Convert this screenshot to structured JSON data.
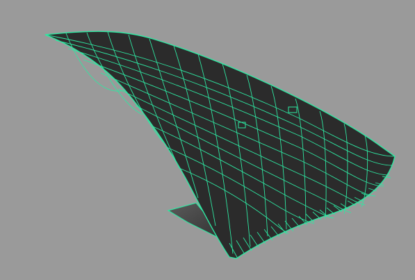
{
  "viewport": {
    "background_color": "#9a9a9a"
  },
  "mesh": {
    "wire_color": "#2ee8a2",
    "surface_color": "#2b2b2b",
    "back_surface_color": "#3a3a3a"
  }
}
